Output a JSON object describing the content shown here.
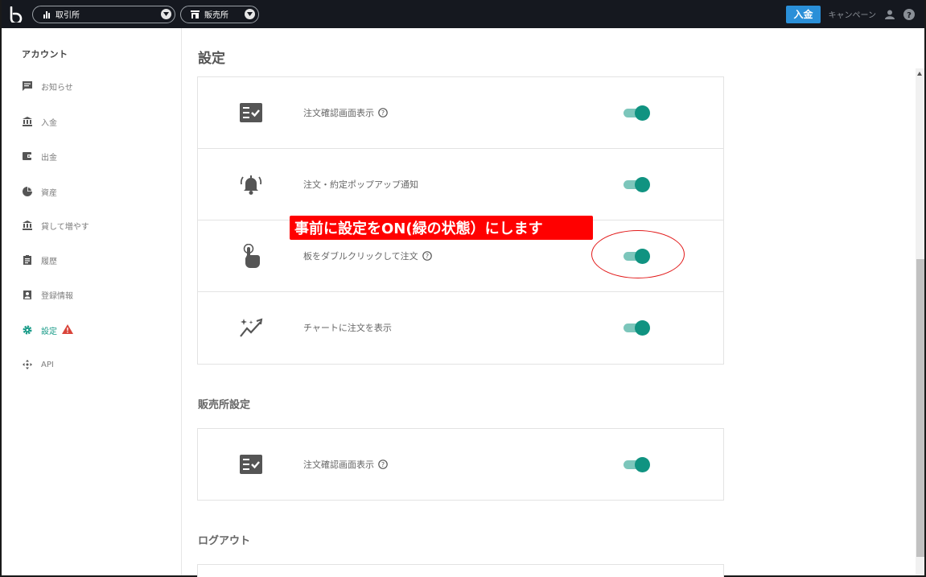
{
  "topbar": {
    "exchange_label": "取引所",
    "store_label": "販売所",
    "deposit_label": "入金",
    "campaign_label": "キャンペーン"
  },
  "sidebar": {
    "heading": "アカウント",
    "items": [
      {
        "label": "お知らせ",
        "icon": "message-icon"
      },
      {
        "label": "入金",
        "icon": "bank-icon"
      },
      {
        "label": "出金",
        "icon": "wallet-icon"
      },
      {
        "label": "資産",
        "icon": "pie-chart-icon"
      },
      {
        "label": "貸して増やす",
        "icon": "bank-icon"
      },
      {
        "label": "履歴",
        "icon": "clipboard-icon"
      },
      {
        "label": "登録情報",
        "icon": "id-badge-icon"
      },
      {
        "label": "設定",
        "icon": "gear-icon",
        "active": true
      },
      {
        "label": "API",
        "icon": "move-icon"
      }
    ]
  },
  "main": {
    "title": "設定",
    "settings_rows": [
      {
        "label": "注文確認画面表示",
        "icon": "checklist-icon",
        "help": true,
        "enabled": true
      },
      {
        "label": "注文・約定ポップアップ通知",
        "icon": "bell-ring-icon",
        "help": false,
        "enabled": true
      },
      {
        "label": "板をダブルクリックして注文",
        "icon": "touch-icon",
        "help": true,
        "enabled": true
      },
      {
        "label": "チャートに注文を表示",
        "icon": "sparkle-chart-icon",
        "help": false,
        "enabled": true
      }
    ],
    "store_section_title": "販売所設定",
    "store_rows": [
      {
        "label": "注文確認画面表示",
        "icon": "checklist-icon",
        "help": true,
        "enabled": true
      }
    ],
    "logout_title": "ログアウト"
  },
  "annotation": {
    "callout_text": "事前に設定をON(緑の状態）にします"
  },
  "colors": {
    "accent": "#109381",
    "topbar": "#15181f",
    "deposit_button": "#2a8fd8",
    "callout": "#ff0000"
  }
}
